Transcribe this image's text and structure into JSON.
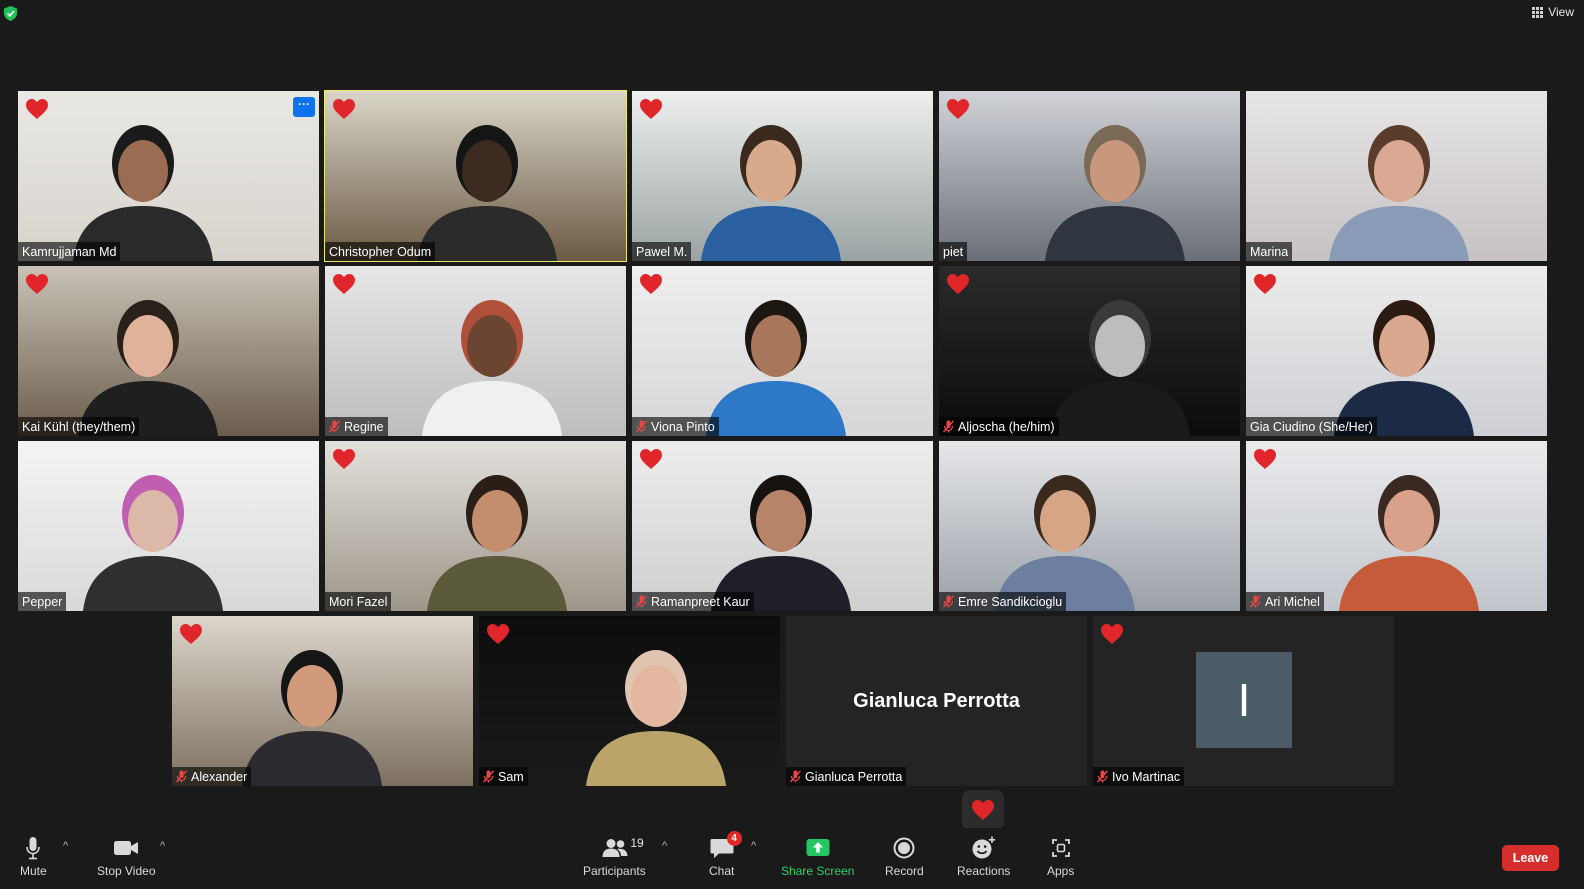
{
  "topbar": {
    "view_label": "View"
  },
  "participants": [
    {
      "name": "Kamrujjaman Md",
      "muted": false,
      "reaction": true,
      "active": false
    },
    {
      "name": "Christopher Odum",
      "muted": false,
      "reaction": true,
      "active": true
    },
    {
      "name": "Pawel M.",
      "muted": false,
      "reaction": true,
      "active": false
    },
    {
      "name": "piet",
      "muted": false,
      "reaction": true,
      "active": false
    },
    {
      "name": "Marina",
      "muted": false,
      "reaction": false,
      "active": false
    },
    {
      "name": "Kai Kühl (they/them)",
      "muted": false,
      "reaction": true,
      "active": false
    },
    {
      "name": "Regine",
      "muted": true,
      "reaction": true,
      "active": false
    },
    {
      "name": "Viona Pinto",
      "muted": true,
      "reaction": true,
      "active": false
    },
    {
      "name": "Aljoscha (he/him)",
      "muted": true,
      "reaction": true,
      "active": false
    },
    {
      "name": "Gia Ciudino (She/Her)",
      "muted": false,
      "reaction": true,
      "active": false
    },
    {
      "name": "Pepper",
      "muted": false,
      "reaction": false,
      "active": false
    },
    {
      "name": "Mori Fazel",
      "muted": false,
      "reaction": true,
      "active": false
    },
    {
      "name": "Ramanpreet Kaur",
      "muted": true,
      "reaction": true,
      "active": false
    },
    {
      "name": "Emre Sandikcioglu",
      "muted": true,
      "reaction": false,
      "active": false
    },
    {
      "name": "Ari Michel",
      "muted": true,
      "reaction": true,
      "active": false
    },
    {
      "name": "Alexander",
      "muted": true,
      "reaction": true,
      "active": false
    },
    {
      "name": "Sam",
      "muted": true,
      "reaction": true,
      "active": false
    },
    {
      "name": "Gianluca Perrotta",
      "muted": true,
      "reaction": false,
      "active": false,
      "video_off_name": "Gianluca Perrotta"
    },
    {
      "name": "Ivo Martinac",
      "muted": true,
      "reaction": true,
      "active": false,
      "avatar_initial": "I"
    }
  ],
  "toolbar": {
    "mute_label": "Mute",
    "video_label": "Stop Video",
    "participants_label": "Participants",
    "participants_count": "19",
    "chat_label": "Chat",
    "chat_badge": "4",
    "share_label": "Share Screen",
    "record_label": "Record",
    "reactions_label": "Reactions",
    "apps_label": "Apps",
    "leave_label": "Leave"
  },
  "colors": {
    "background": "#1a1a1a",
    "active_speaker": "#ede96b",
    "share_green": "#2fd26a",
    "leave_red": "#d62d2d",
    "heart_red": "#e0262b"
  }
}
